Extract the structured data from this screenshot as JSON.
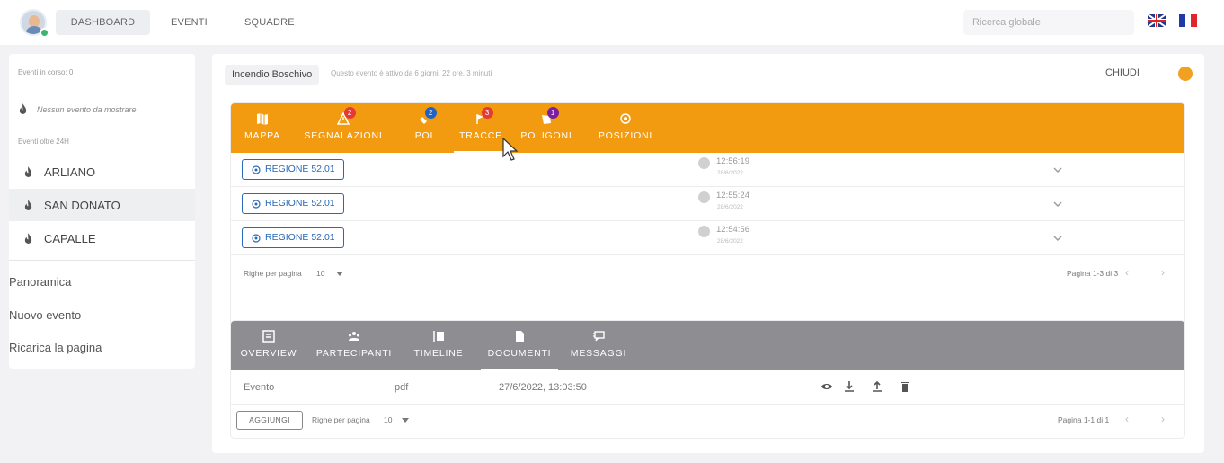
{
  "topbar": {
    "nav": [
      "DASHBOARD",
      "EVENTI",
      "SQUADRE"
    ],
    "search_placeholder": "Ricerca globale",
    "languages": [
      "english-flag",
      "french-flag"
    ]
  },
  "sidebar": {
    "in_progress_label": "Eventi in corso: 0",
    "no_events": "Nessun evento da mostrare",
    "over24_label": "Eventi oltre 24H",
    "events": [
      "ARLIANO",
      "SAN DONATO",
      "CAPALLE"
    ],
    "active_event": "SAN DONATO",
    "links": [
      "Panoramica",
      "Nuovo evento",
      "Ricarica la pagina"
    ]
  },
  "event": {
    "title": "Incendio Boschivo",
    "status": "Questo evento è attivo da 6 giorni, 22 ore, 3 minuti",
    "close_label": "CHIUDI",
    "status_color": "#f2a020"
  },
  "map_tabs": {
    "color": "#f29a10",
    "selected": "TRACCE",
    "tabs": [
      {
        "label": "MAPPA",
        "icon": "map-icon",
        "badge": null
      },
      {
        "label": "SEGNALAZIONI",
        "icon": "warning-icon",
        "badge": "2",
        "badge_color": "#e53935"
      },
      {
        "label": "POI",
        "icon": "poi-icon",
        "badge": "2",
        "badge_color": "#1e63c5"
      },
      {
        "label": "TRACCE",
        "icon": "track-icon",
        "badge": "3",
        "badge_color": "#e53935"
      },
      {
        "label": "POLIGONI",
        "icon": "polygon-icon",
        "badge": "1",
        "badge_color": "#7b1fa2"
      },
      {
        "label": "POSIZIONI",
        "icon": "position-icon",
        "badge": null
      }
    ],
    "rows": [
      {
        "region": "REGIONE 52.01",
        "time": "12:56:19",
        "date": "28/6/2022"
      },
      {
        "region": "REGIONE 52.01",
        "time": "12:55:24",
        "date": "28/6/2022"
      },
      {
        "region": "REGIONE 52.01",
        "time": "12:54:56",
        "date": "28/6/2022"
      }
    ],
    "rows_per_page_label": "Righe per pagina",
    "rows_per_page": "10",
    "pagination": "Pagina 1-3 di 3"
  },
  "doc_tabs": {
    "color": "#8e8e92",
    "selected": "DOCUMENTI",
    "tabs": [
      {
        "label": "OVERVIEW",
        "icon": "overview-icon"
      },
      {
        "label": "PARTECIPANTI",
        "icon": "participants-icon"
      },
      {
        "label": "TIMELINE",
        "icon": "timeline-icon"
      },
      {
        "label": "DOCUMENTI",
        "icon": "document-icon"
      },
      {
        "label": "MESSAGGI",
        "icon": "message-icon"
      }
    ],
    "documents": [
      {
        "name": "Evento",
        "type": "pdf",
        "datetime": "27/6/2022, 13:03:50"
      }
    ],
    "add_label": "AGGIUNGI",
    "rows_per_page_label": "Righe per pagina",
    "rows_per_page": "10",
    "pagination": "Pagina 1-1 di 1"
  }
}
